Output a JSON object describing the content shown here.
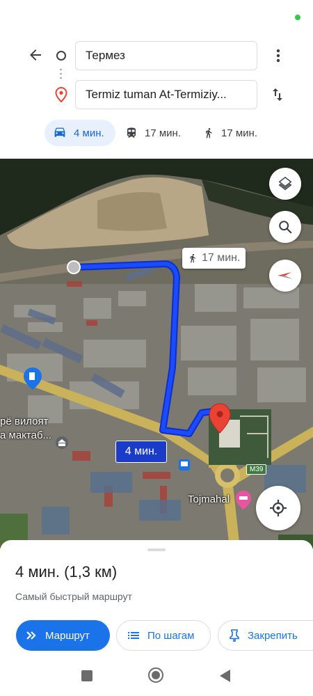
{
  "header": {
    "from_value": "Термез",
    "to_value": "Termiz tuman At-Termiziy...",
    "back_icon": "arrow-back-icon",
    "more_icon": "more-vert-icon",
    "swap_icon": "swap-vert-icon"
  },
  "modes": [
    {
      "icon": "car-icon",
      "label": "4 мин.",
      "selected": true
    },
    {
      "icon": "transit-icon",
      "label": "17 мин.",
      "selected": false
    },
    {
      "icon": "walk-icon",
      "label": "17 мин.",
      "selected": false
    }
  ],
  "map": {
    "walk_label": "17 мин.",
    "car_label": "4 мин.",
    "place_label": "Tojmahal",
    "road_shield": "M39",
    "text_line1": "рё вилоят",
    "text_line2": "а мактаб..."
  },
  "sheet": {
    "duration": "4 мин. (1,3 км)",
    "description": "Самый быстрый маршрут",
    "route_button": "Маршрут",
    "steps_button": "По шагам",
    "pin_button": "Закрепить"
  },
  "colors": {
    "accent": "#1a73e8",
    "route": "#1a4bff",
    "destination": "#ea4335"
  }
}
